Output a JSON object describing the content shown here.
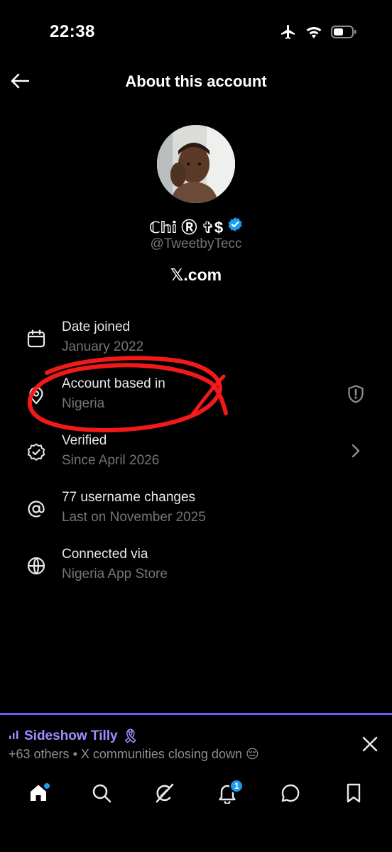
{
  "status_bar": {
    "time": "22:38"
  },
  "header": {
    "title": "About this account"
  },
  "profile": {
    "display_name": "ℂ𝕙𝕚 Ⓡ ✞$",
    "handle": "@TweetbyTecc",
    "website": "𝕏.com"
  },
  "info": {
    "date_joined": {
      "label": "Date joined",
      "value": "January 2022"
    },
    "account_based": {
      "label": "Account based in",
      "value": "Nigeria"
    },
    "verified": {
      "label": "Verified",
      "value": "Since April 2026"
    },
    "username_changes": {
      "label": "77 username changes",
      "value": "Last on November 2025"
    },
    "connected": {
      "label": "Connected via",
      "value": "Nigeria App Store"
    }
  },
  "spaces": {
    "title": "Sideshow Tilly",
    "title_emoji": "🎗",
    "subtitle": "+63 others • X communities closing down 😔"
  },
  "nav": {
    "notifications_badge": "1"
  },
  "colors": {
    "background": "#000000",
    "primary_text": "#e7e9ea",
    "secondary_text": "#71767b",
    "verified_blue": "#1d9bf0",
    "spaces_purple": "#7856ff",
    "annotation_red": "#ff1a1a"
  }
}
